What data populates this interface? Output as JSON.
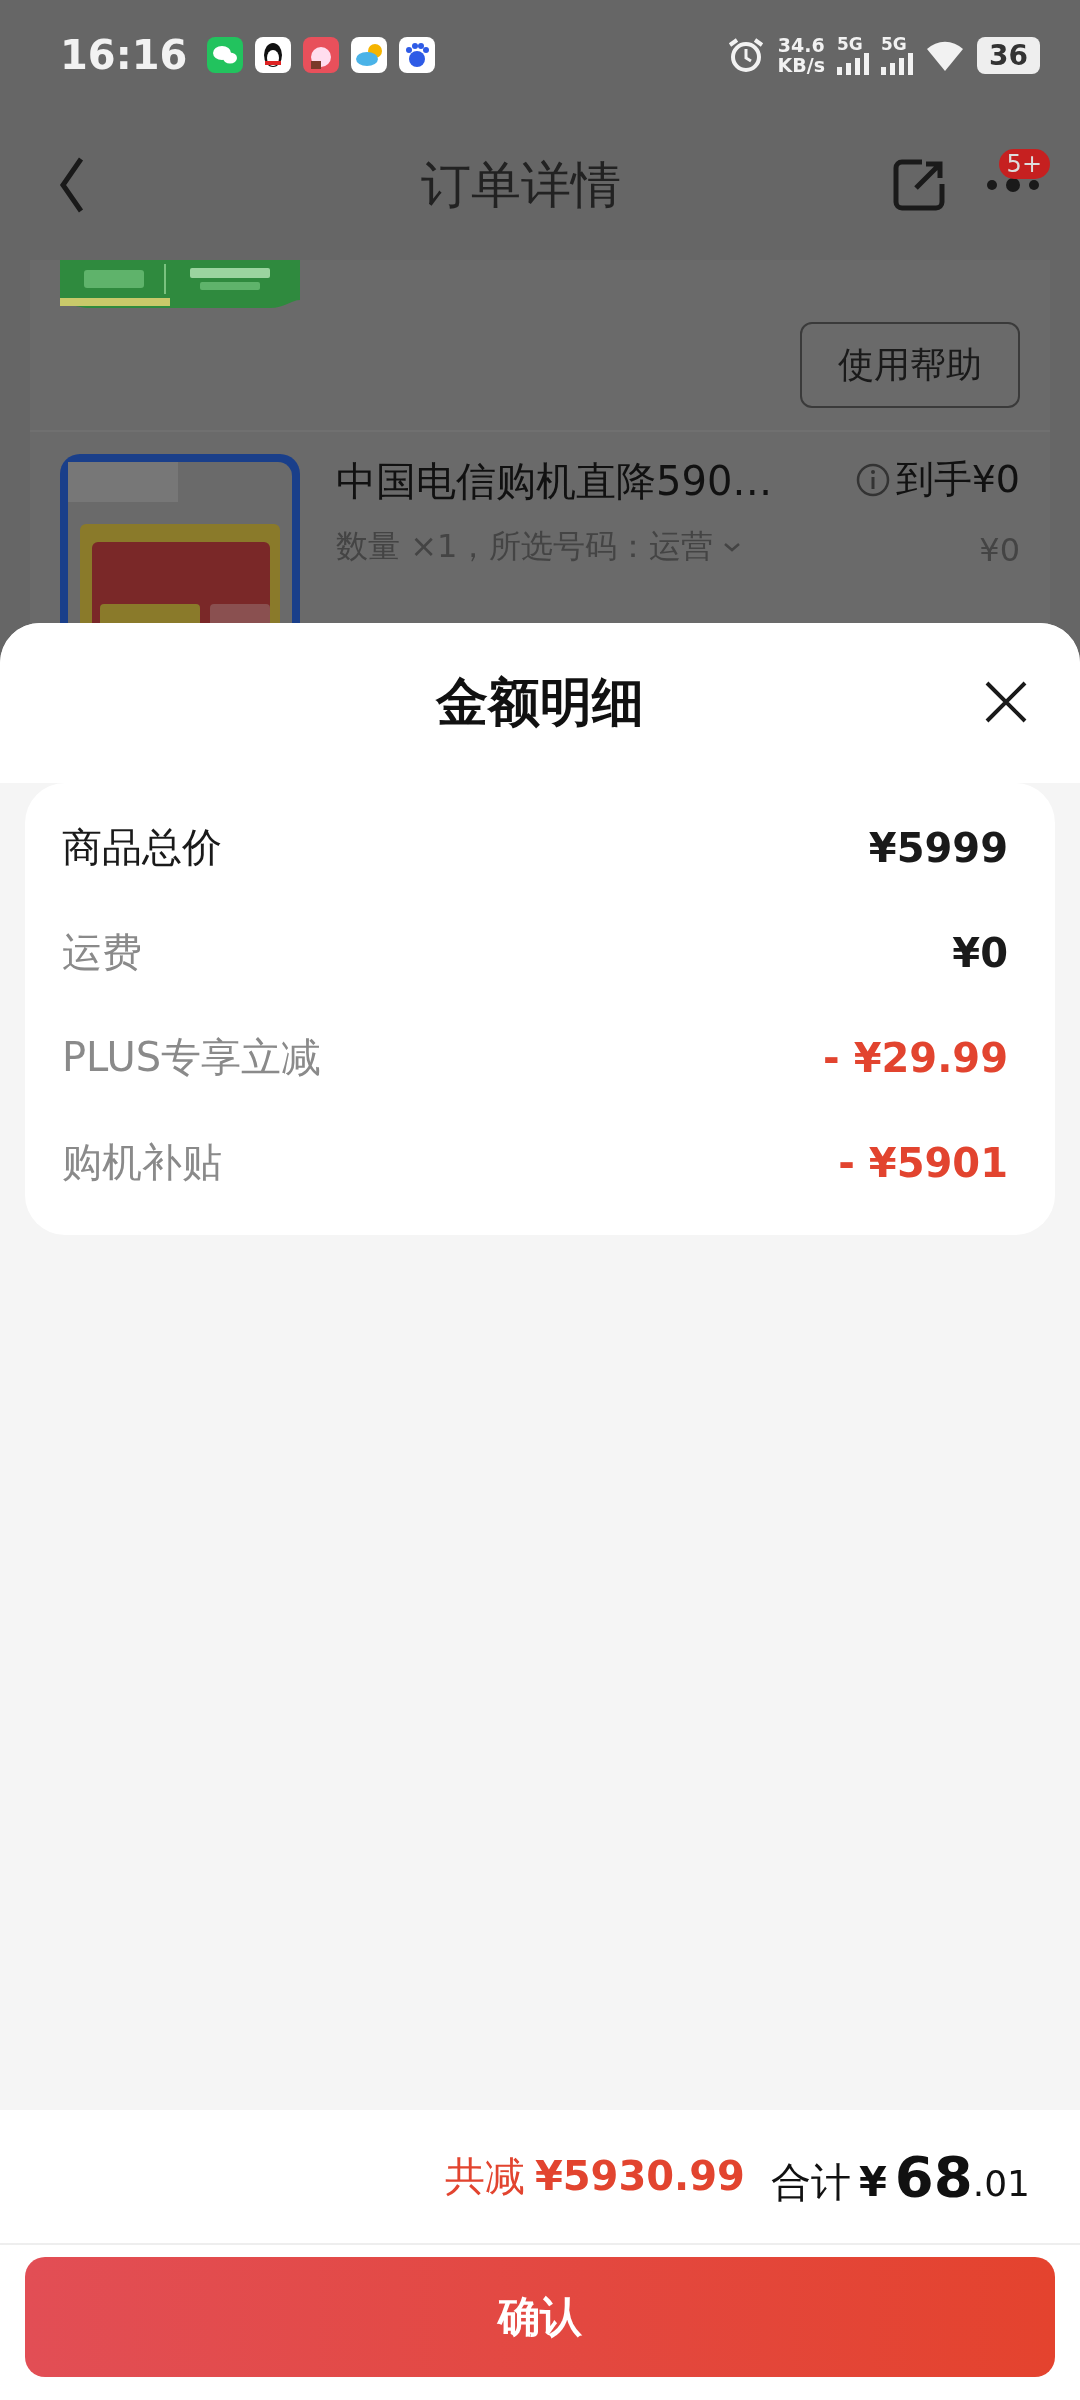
{
  "status_bar": {
    "time": "16:16",
    "net_speed": "34.6",
    "net_unit": "KB/s",
    "sim_1": "5G",
    "sim_2": "5G",
    "battery": "36"
  },
  "nav": {
    "title": "订单详情",
    "badge": "5+"
  },
  "order": {
    "help_button": "使用帮助",
    "item": {
      "title": "中国电信购机直降590…",
      "spec": "数量 ×1，所选号码：运营",
      "price_label": "到手¥0",
      "price": "¥0"
    }
  },
  "sheet": {
    "title": "金额明细",
    "rows": [
      {
        "label": "商品总价",
        "value": "¥5999",
        "kind": "total"
      },
      {
        "label": "运费",
        "value": "¥0",
        "kind": "normal"
      },
      {
        "label": "PLUS专享立减",
        "value": "- ¥29.99",
        "kind": "discount"
      },
      {
        "label": "购机补贴",
        "value": "- ¥5901",
        "kind": "discount"
      }
    ]
  },
  "footer": {
    "discount_label": "共减",
    "discount": "¥5930.99",
    "total_label": "合计",
    "total_symbol": "¥",
    "total_int": "68",
    "total_dec": ".01",
    "confirm": "确认"
  }
}
